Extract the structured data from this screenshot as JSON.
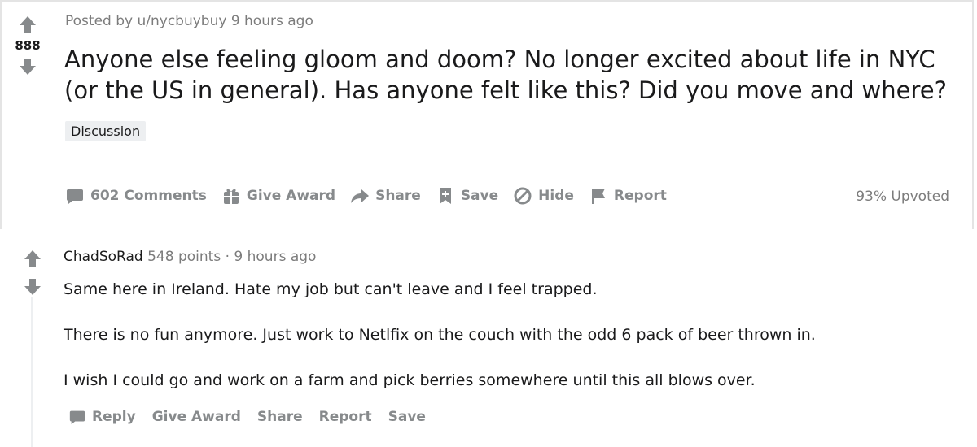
{
  "post": {
    "score": "888",
    "posted_by": "Posted by u/nycbuybuy 9 hours ago",
    "title": "Anyone else feeling gloom and doom? No longer excited about life in NYC (or the US in general). Has anyone felt like this? Did you move and where?",
    "flair": "Discussion",
    "actions": {
      "comments": "602 Comments",
      "award": "Give Award",
      "share": "Share",
      "save": "Save",
      "hide": "Hide",
      "report": "Report"
    },
    "upvoted": "93% Upvoted"
  },
  "comment": {
    "author": "ChadSoRad",
    "points": "548 points",
    "separator": "·",
    "time": "9 hours ago",
    "paragraphs": [
      "Same here in Ireland. Hate my job but can't leave and I feel trapped.",
      "There is no fun anymore. Just work to Netlfix on the couch with the odd 6 pack of beer thrown in.",
      "I wish I could go and work on a farm and pick berries somewhere until this all blows over."
    ],
    "actions": {
      "reply": "Reply",
      "award": "Give Award",
      "share": "Share",
      "report": "Report",
      "save": "Save"
    }
  },
  "icons": {
    "upvote": "upvote-arrow-icon",
    "downvote": "downvote-arrow-icon",
    "comments": "comment-bubble-icon",
    "award": "gift-icon",
    "share": "share-arrow-icon",
    "save": "bookmark-icon",
    "hide": "hide-circle-slash-icon",
    "report": "flag-icon",
    "reply": "comment-bubble-icon"
  },
  "colors": {
    "icon_gray": "#878a8c",
    "text_dark": "#1a1a1b",
    "meta_gray": "#7c7c7c",
    "flair_bg": "#edeff1"
  }
}
